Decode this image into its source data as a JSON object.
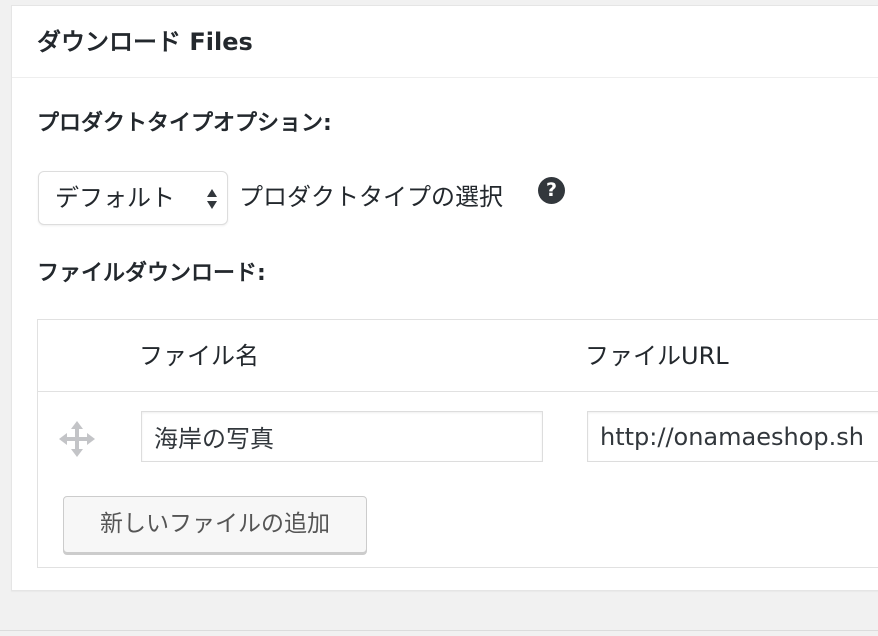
{
  "metabox": {
    "title": "ダウンロード Files"
  },
  "product_type": {
    "label": "プロダクトタイプオプション:",
    "select_value": "デフォルト",
    "help_text": "プロダクトタイプの選択",
    "help_icon": "question-mark-icon",
    "help_glyph": "?"
  },
  "file_downloads": {
    "label": "ファイルダウンロード:",
    "columns": [
      "ファイル名",
      "ファイルURL"
    ],
    "rows": [
      {
        "drag_icon": "move-arrows-icon",
        "name": "海岸の写真",
        "url": "http://onamaeshop.sh"
      }
    ],
    "add_button_label": "新しいファイルの追加"
  }
}
